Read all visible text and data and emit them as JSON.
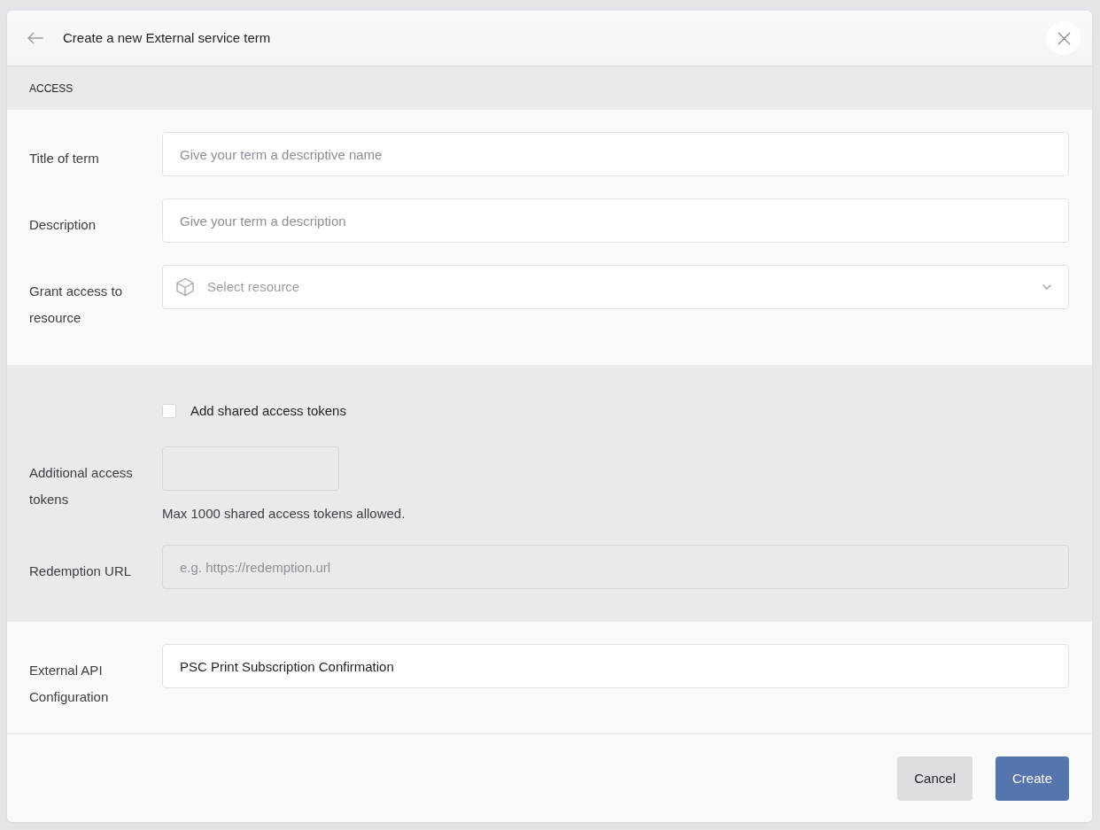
{
  "dialog": {
    "title": "Create a new External service term"
  },
  "section_header": {
    "title": "ACCESS"
  },
  "sections": [
    {
      "shaded": false,
      "fields": [
        {
          "kind": "text",
          "label": "Title of term",
          "placeholder": "Give your term a descriptive name",
          "disabled": false
        },
        {
          "kind": "text",
          "label": "Description",
          "placeholder": "Give your term a description",
          "disabled": false
        },
        {
          "kind": "select",
          "label": "Grant access to resource",
          "placeholder": "Select resource",
          "disabled": false
        }
      ]
    },
    {
      "shaded": true,
      "fields": [
        {
          "kind": "checkbox",
          "label": "Add shared access tokens",
          "checked": false
        },
        {
          "kind": "number",
          "label": "Additional access tokens",
          "help": "Max 1000 shared access tokens allowed.",
          "disabled": true
        },
        {
          "kind": "text",
          "label": "Redemption URL",
          "placeholder": "e.g. https://redemption.url",
          "disabled": true
        }
      ]
    },
    {
      "shaded": false,
      "fields": [
        {
          "kind": "text",
          "label": "External API Configuration",
          "value": "PSC Print Subscription Confirmation",
          "disabled": false
        }
      ]
    }
  ],
  "buttons": [
    {
      "kind": "secondary",
      "label": "Cancel"
    },
    {
      "kind": "primary",
      "label": "Create"
    }
  ]
}
